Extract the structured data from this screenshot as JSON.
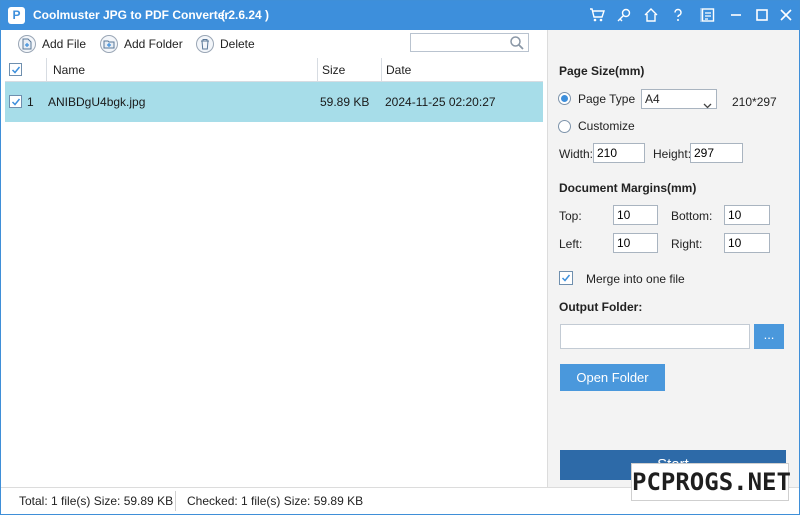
{
  "window": {
    "title": "Coolmuster JPG to PDF Converter",
    "version": "( 2.6.24 )",
    "logo_text": "P",
    "controls": [
      "cart-icon",
      "key-icon",
      "home-icon",
      "help-icon",
      "feedback-icon",
      "minimize-icon",
      "maximize-icon",
      "close-icon"
    ]
  },
  "toolbar": {
    "add_file": "Add File",
    "add_folder": "Add Folder",
    "delete": "Delete",
    "search_value": ""
  },
  "table": {
    "columns": {
      "name": "Name",
      "size": "Size",
      "date": "Date"
    },
    "rows": [
      {
        "index": "1",
        "checked": true,
        "name": "ANIBDgU4bgk.jpg",
        "size": "59.89 KB",
        "date": "2024-11-25 02:20:27"
      }
    ],
    "row_highlight": "#a7dde9"
  },
  "settings": {
    "page_size_title": "Page Size(mm)",
    "page_type_label": "Page Type",
    "page_type_selected": "A4",
    "page_type_dims": "210*297",
    "customize_label": "Customize",
    "width_label": "Width:",
    "width_value": "210",
    "height_label": "Height:",
    "height_value": "297",
    "margins_title": "Document Margins(mm)",
    "top_label": "Top:",
    "top_value": "10",
    "bottom_label": "Bottom:",
    "bottom_value": "10",
    "left_label": "Left:",
    "left_value": "10",
    "right_label": "Right:",
    "right_value": "10",
    "merge_label": "Merge into one file",
    "merge_checked": true,
    "output_folder_title": "Output Folder:",
    "output_folder_value": "",
    "browse_label": "...",
    "open_folder_label": "Open Folder",
    "start_label": "Start"
  },
  "status": {
    "total": "Total: 1 file(s) Size: 59.89 KB",
    "checked": "Checked: 1 file(s) Size: 59.89 KB"
  },
  "watermark": "PCPROGS.NET",
  "colors": {
    "accent": "#3d8fdc",
    "button": "#4a98dc",
    "start_button": "#2d6aa8"
  }
}
